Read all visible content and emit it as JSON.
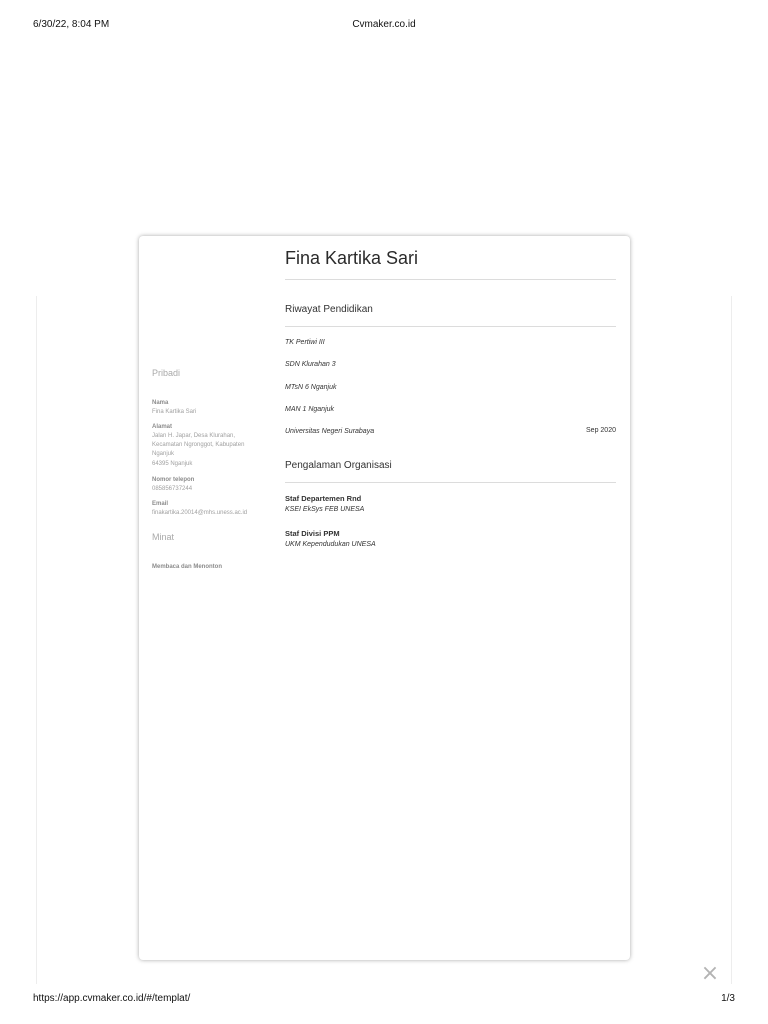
{
  "print_header": {
    "datetime": "6/30/22, 8:04 PM",
    "site_title": "Cvmaker.co.id"
  },
  "print_footer": {
    "url": "https://app.cvmaker.co.id/#/templat/",
    "page_number": "1/3"
  },
  "close_icon": "×",
  "cv": {
    "name": "Fina Kartika Sari",
    "education": {
      "title": "Riwayat Pendidikan",
      "items": [
        {
          "school": "TK Pertiwi III",
          "date": ""
        },
        {
          "school": "SDN Klurahan 3",
          "date": ""
        },
        {
          "school": "MTsN 6 Nganjuk",
          "date": ""
        },
        {
          "school": "MAN 1 Nganjuk",
          "date": ""
        },
        {
          "school": "Universitas Negeri Surabaya",
          "date": "Sep 2020"
        }
      ]
    },
    "organization": {
      "title": "Pengalaman Organisasi",
      "items": [
        {
          "role": "Staf Departemen Rnd",
          "org": "KSEI EkSys FEB UNESA"
        },
        {
          "role": "Staf Divisi PPM",
          "org": "UKM Kependudukan UNESA"
        }
      ]
    },
    "sidebar": {
      "personal_title": "Pribadi",
      "name_label": "Nama",
      "name_value": "Fina Kartika Sari",
      "address_label": "Alamat",
      "address_lines": [
        "Jalan H. Japar, Desa Klurahan,",
        "Kecamatan Ngronggot, Kabupaten",
        "Nganjuk",
        "64395 Nganjuk"
      ],
      "phone_label": "Nomor telepon",
      "phone_value": "085856737244",
      "email_label": "Email",
      "email_value": "finakartika.20014@mhs.uness.ac.id",
      "interests_title": "Minat",
      "interests_value": "Membaca dan Menonton"
    }
  }
}
